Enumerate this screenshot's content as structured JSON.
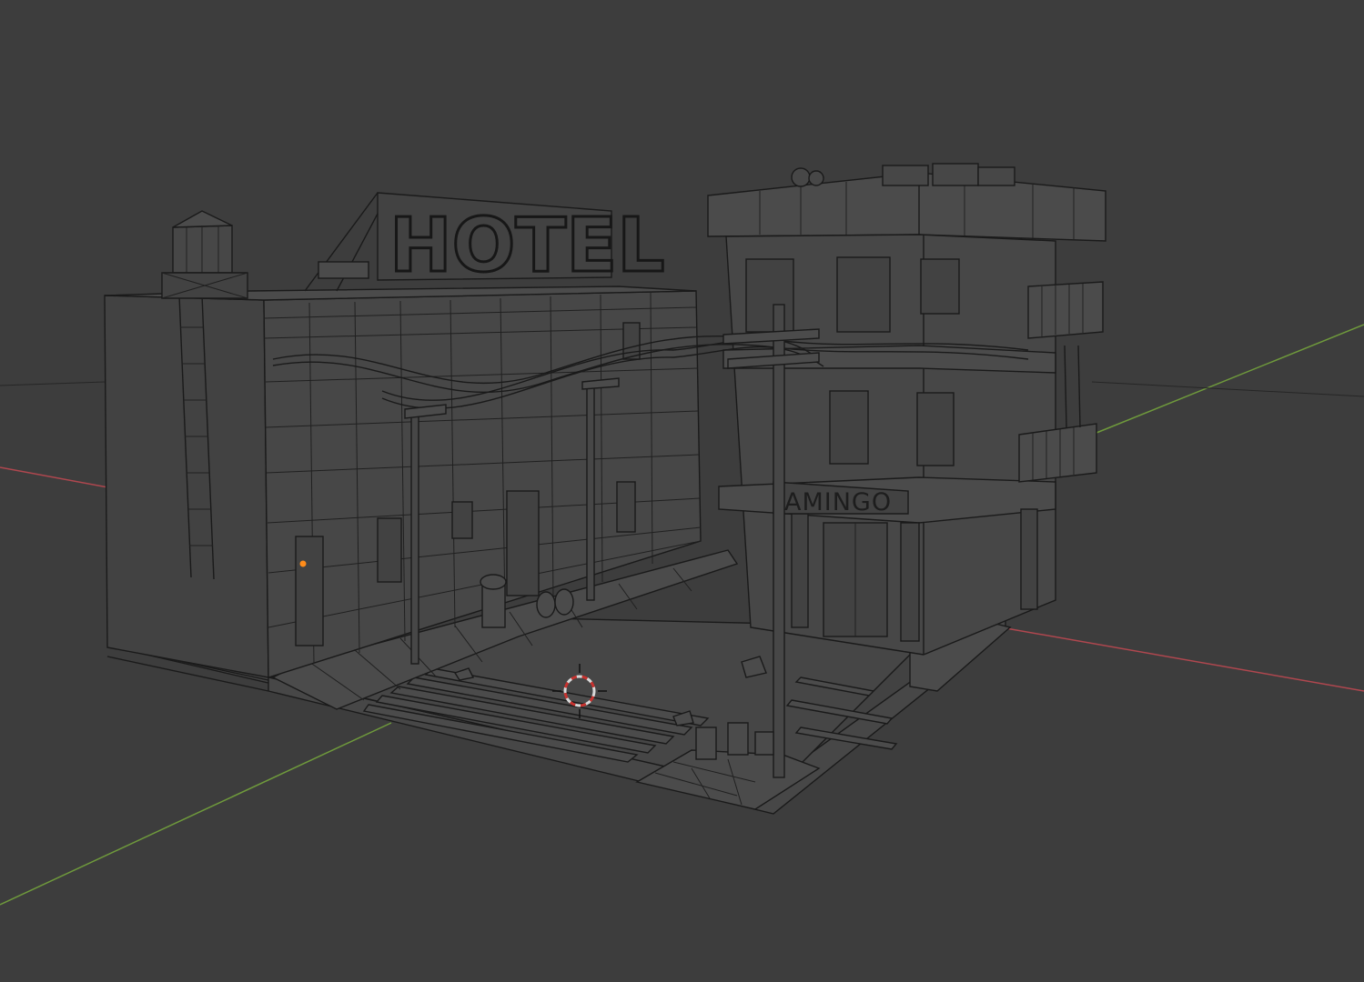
{
  "viewport": {
    "mode": "3d-viewport-wireframe",
    "background": "#3d3d3d",
    "wire_color": "#1a1a1a",
    "x_axis_color": "#b0474f",
    "y_axis_color": "#6f9a3c",
    "cursor_colors": [
      "#d9d9d9",
      "#c8322f"
    ],
    "origin_color": "#ff8c1a"
  },
  "scene": {
    "hotel_sign": "HOTEL",
    "storefront_sign": "AMINGO",
    "icons": [
      "3d-cursor-icon",
      "object-origin-icon"
    ]
  }
}
